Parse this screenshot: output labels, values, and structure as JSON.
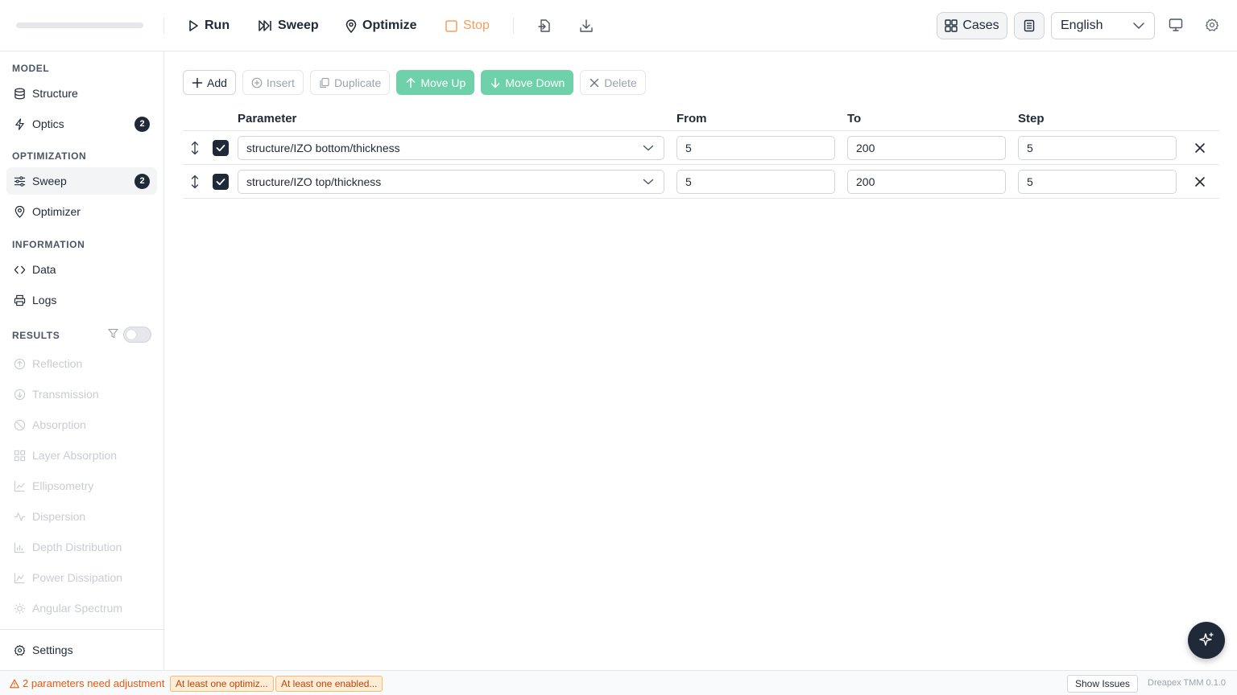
{
  "toolbar": {
    "run_label": "Run",
    "sweep_label": "Sweep",
    "optimize_label": "Optimize",
    "stop_label": "Stop",
    "cases_label": "Cases",
    "language": "English"
  },
  "sidebar": {
    "sections": {
      "model": "MODEL",
      "optimization": "OPTIMIZATION",
      "information": "INFORMATION",
      "results": "RESULTS"
    },
    "model_items": [
      {
        "label": "Structure",
        "icon": "database-icon"
      },
      {
        "label": "Optics",
        "icon": "bolt-icon",
        "badge": "2"
      }
    ],
    "optimization_items": [
      {
        "label": "Sweep",
        "icon": "sliders-icon",
        "badge": "2",
        "active": true
      },
      {
        "label": "Optimizer",
        "icon": "map-pin-icon"
      }
    ],
    "information_items": [
      {
        "label": "Data",
        "icon": "code-icon"
      },
      {
        "label": "Logs",
        "icon": "printer-icon"
      }
    ],
    "results_items": [
      {
        "label": "Reflection",
        "icon": "arrow-up-circle-icon"
      },
      {
        "label": "Transmission",
        "icon": "arrow-down-circle-icon"
      },
      {
        "label": "Absorption",
        "icon": "ban-icon"
      },
      {
        "label": "Layer Absorption",
        "icon": "grid-icon"
      },
      {
        "label": "Ellipsometry",
        "icon": "line-chart-icon"
      },
      {
        "label": "Dispersion",
        "icon": "activity-icon"
      },
      {
        "label": "Depth Distribution",
        "icon": "bar-chart-icon"
      },
      {
        "label": "Power Dissipation",
        "icon": "area-chart-icon"
      },
      {
        "label": "Angular Spectrum",
        "icon": "sun-icon"
      }
    ],
    "results_toggle_on": false,
    "settings_label": "Settings"
  },
  "actions": {
    "add": "Add",
    "insert": "Insert",
    "duplicate": "Duplicate",
    "move_up": "Move Up",
    "move_down": "Move Down",
    "delete": "Delete"
  },
  "table": {
    "headers": {
      "parameter": "Parameter",
      "from": "From",
      "to": "To",
      "step": "Step"
    },
    "rows": [
      {
        "checked": true,
        "parameter": "structure/IZO bottom/thickness",
        "from": "5",
        "to": "200",
        "step": "5"
      },
      {
        "checked": true,
        "parameter": "structure/IZO top/thickness",
        "from": "5",
        "to": "200",
        "step": "5"
      }
    ]
  },
  "status": {
    "warning": "2 parameters need adjustment",
    "chips": [
      "At least one optimiz...",
      "At least one enabled..."
    ],
    "show_issues": "Show Issues",
    "version": "Dreapex TMM 0.1.0"
  },
  "colors": {
    "accent_green": "#6fd1a9",
    "stop_orange": "#f59e5b",
    "warning_orange": "#ea580c",
    "dark": "#1f2937"
  }
}
